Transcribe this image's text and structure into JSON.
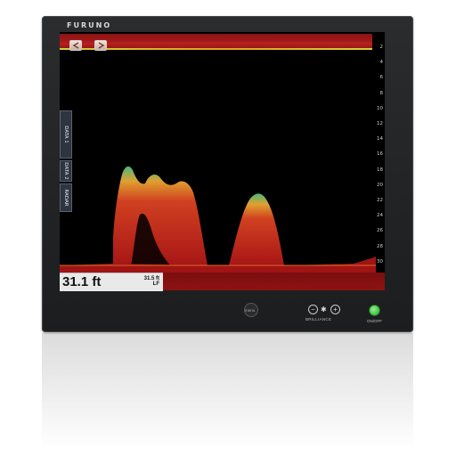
{
  "device": {
    "brand": "FURUNO"
  },
  "toolbar": {
    "buttons": [
      {
        "icon": "back-arrow-icon"
      },
      {
        "icon": "forward-arrow-icon"
      }
    ]
  },
  "side_tabs": [
    {
      "label": "DATA 1"
    },
    {
      "label": "DATA 2"
    },
    {
      "label": "RADAR"
    }
  ],
  "depth_scale": {
    "ticks": [
      "2",
      "4",
      "6",
      "8",
      "10",
      "12",
      "14",
      "16",
      "18",
      "20",
      "22",
      "24",
      "26",
      "28",
      "30",
      "32"
    ]
  },
  "readout": {
    "depth": "31.1 ft",
    "secondary_depth": "31.5 ft",
    "frequency": "LF"
  },
  "hardware": {
    "menu_label": "menu",
    "brilliance_label": "BRILLIANCE",
    "power_label": "ON/OFF"
  },
  "colors": {
    "echo_strong": "#c02020",
    "echo_medium": "#e07030",
    "echo_weak": "#4ab87a",
    "bottom": "#8e1212"
  }
}
